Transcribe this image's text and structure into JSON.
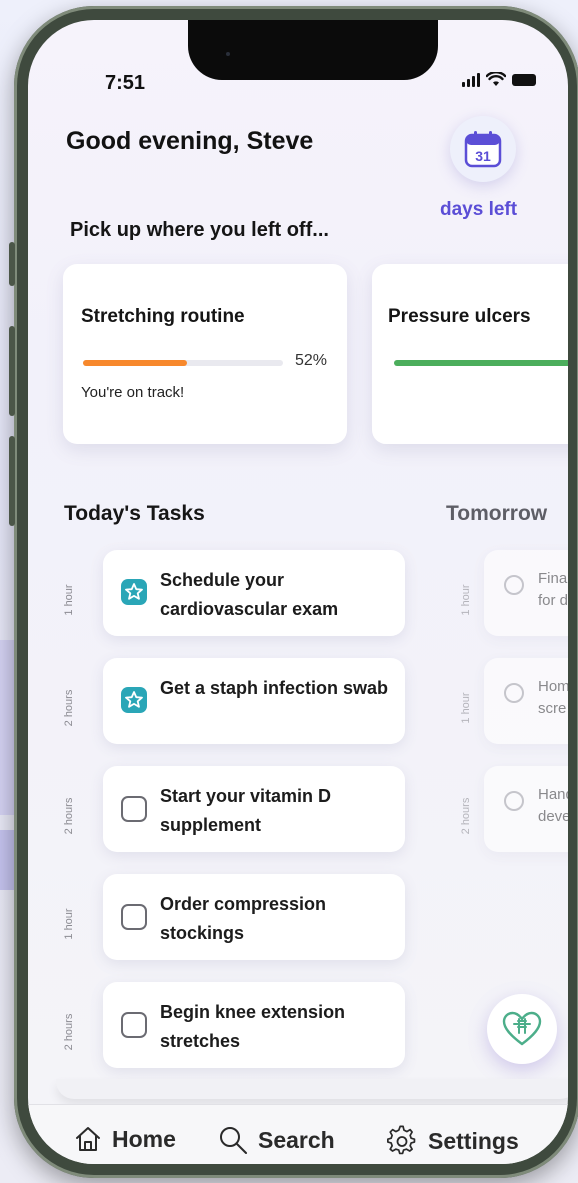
{
  "status": {
    "time": "7:51"
  },
  "header": {
    "greeting": "Good evening, Steve",
    "calendar_day": "31",
    "days_left_label": "days left"
  },
  "continue": {
    "title": "Pick up where you left off...",
    "cards": [
      {
        "title": "Stretching routine",
        "progress_percent": 52,
        "progress_label": "52%",
        "status": "You're on track!",
        "bar_color": "#f7882c"
      },
      {
        "title": "Pressure ulcers",
        "progress_percent": 95,
        "bar_color": "#4cae5c"
      }
    ]
  },
  "today": {
    "title": "Today's Tasks",
    "tasks": [
      {
        "duration": "1 hour",
        "text": "Schedule your cardiovascular exam",
        "icon": "star-badge-icon"
      },
      {
        "duration": "2 hours",
        "text": "Get a staph infection swab",
        "icon": "star-badge-icon"
      },
      {
        "duration": "2 hours",
        "text": "Start your vitamin D supplement",
        "icon": "checkbox"
      },
      {
        "duration": "1 hour",
        "text": "Order compression stockings",
        "icon": "checkbox"
      },
      {
        "duration": "2 hours",
        "text": "Begin knee extension stretches",
        "icon": "checkbox"
      }
    ]
  },
  "tomorrow": {
    "title": "Tomorrow",
    "tasks": [
      {
        "duration": "1 hour",
        "text": "Finali\nfor d"
      },
      {
        "duration": "1 hour",
        "text": "Hom\nscre"
      },
      {
        "duration": "2 hours",
        "text": "Hand\ndeve"
      }
    ]
  },
  "nav": {
    "home": "Home",
    "search": "Search",
    "settings": "Settings"
  },
  "colors": {
    "accent": "#5b4ed6",
    "teal_badge": "#2aa6b7",
    "orange": "#f7882c",
    "green": "#4cae5c"
  }
}
